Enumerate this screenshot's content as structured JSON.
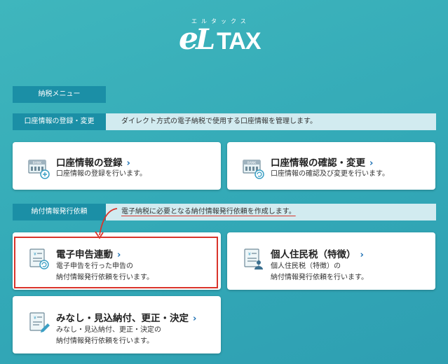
{
  "logo": {
    "kana": "エルタックス",
    "e": "e",
    "l": "L",
    "tax": "TAX"
  },
  "menu_tag": "納税メニュー",
  "sections": [
    {
      "label": "口座情報の登録・変更",
      "description": "ダイレクト方式の電子納税で使用する口座情報を管理します。"
    },
    {
      "label": "納付情報発行依頼",
      "description": "電子納税に必要となる納付情報発行依頼を作成します。"
    }
  ],
  "cards": [
    {
      "title": "口座情報の登録",
      "lines": [
        "口座情報の登録を行います。"
      ],
      "icon": "bank-add-icon"
    },
    {
      "title": "口座情報の確認・変更",
      "lines": [
        "口座情報の確認及び変更を行います。"
      ],
      "icon": "bank-refresh-icon"
    },
    {
      "title": "電子申告連動",
      "lines": [
        "電子申告を行った申告の",
        "納付情報発行依頼を行います。"
      ],
      "icon": "document-refresh-icon"
    },
    {
      "title": "個人住民税（特徴）",
      "lines": [
        "個人住民税（特徴）の",
        "納付情報発行依頼を行います。"
      ],
      "icon": "document-person-icon"
    },
    {
      "title": "みなし・見込納付、更正・決定",
      "lines": [
        "みなし・見込納付、更正・決定の",
        "納付情報発行依頼を行います。"
      ],
      "icon": "document-edit-icon"
    }
  ],
  "chevron": "›",
  "colors": {
    "accent": "#1b8fa6",
    "link": "#1b6fb3",
    "highlight": "#d9342b",
    "section_bg": "#d2ebf0"
  }
}
